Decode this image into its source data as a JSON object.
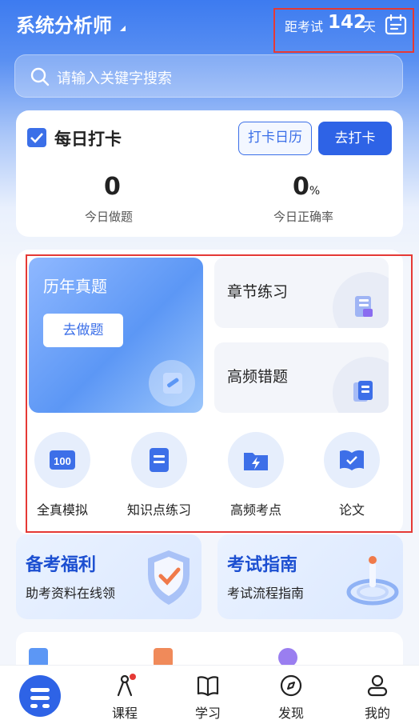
{
  "header": {
    "app_title": "系统分析师",
    "countdown_prefix": "距考试",
    "countdown_days": "142",
    "countdown_suffix": "天"
  },
  "search": {
    "placeholder": "请输入关键字搜索"
  },
  "checkin": {
    "title": "每日打卡",
    "calendar_button": "打卡日历",
    "checkin_button": "去打卡",
    "today_questions_value": "0",
    "today_questions_label": "今日做题",
    "accuracy_value": "0",
    "accuracy_unit": "%",
    "accuracy_label": "今日正确率"
  },
  "practice": {
    "past_papers_title": "历年真题",
    "past_papers_button": "去做题",
    "chapter_practice": "章节练习",
    "frequent_mistakes": "高频错题",
    "tools": [
      {
        "label": "全真模拟",
        "icon": "exam-100-icon"
      },
      {
        "label": "知识点练习",
        "icon": "notebook-icon"
      },
      {
        "label": "高频考点",
        "icon": "lightning-folder-icon"
      },
      {
        "label": "论文",
        "icon": "open-book-icon"
      }
    ]
  },
  "promos": [
    {
      "title": "备考福利",
      "subtitle": "助考资料在线领",
      "icon": "shield-check-icon"
    },
    {
      "title": "考试指南",
      "subtitle": "考试流程指南",
      "icon": "target-person-icon"
    }
  ],
  "bottom_tabs": [
    {
      "label": "",
      "icon": "home-logo-icon"
    },
    {
      "label": "课程",
      "icon": "compass-pen-icon"
    },
    {
      "label": "学习",
      "icon": "book-icon"
    },
    {
      "label": "发现",
      "icon": "compass-icon"
    },
    {
      "label": "我的",
      "icon": "user-icon"
    }
  ],
  "colors": {
    "primary": "#2e63e6",
    "highlight_box": "#e53935"
  }
}
